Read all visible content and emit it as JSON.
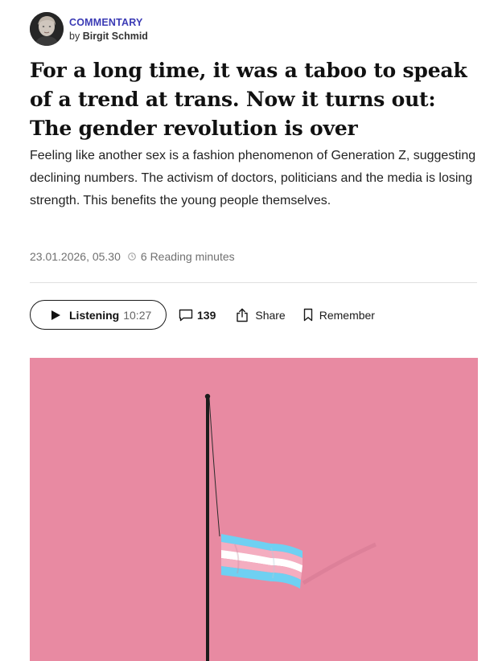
{
  "author": {
    "kicker": "COMMENTARY",
    "by": "by",
    "name": "Birgit Schmid"
  },
  "article": {
    "headline": "For a long time, it was a taboo to speak of a trend at trans. Now it turns out: The gender revolution is over",
    "lead": "Feeling like another sex is a fashion phenomenon of Generation Z, suggesting declining numbers. The activism of doctors, politicians and the media is losing strength. This benefits the young people themselves.",
    "date": "23.01.2026, 05.30",
    "reading_time": "6 Reading minutes"
  },
  "actions": {
    "listen_label": "Listening",
    "listen_time": "10:27",
    "comment_count": "139",
    "share_label": "Share",
    "remember_label": "Remember"
  },
  "icons": {
    "play": "play-icon",
    "comment": "comment-bubble-icon",
    "share": "share-icon",
    "remember": "bookmark-icon",
    "clock": "clock-icon"
  },
  "colors": {
    "kicker": "#3b3bb5",
    "hero_background": "#e88aa2",
    "flag_blue": "#5bcefa",
    "flag_pink": "#f5a9b8",
    "flag_white": "#ffffff"
  }
}
